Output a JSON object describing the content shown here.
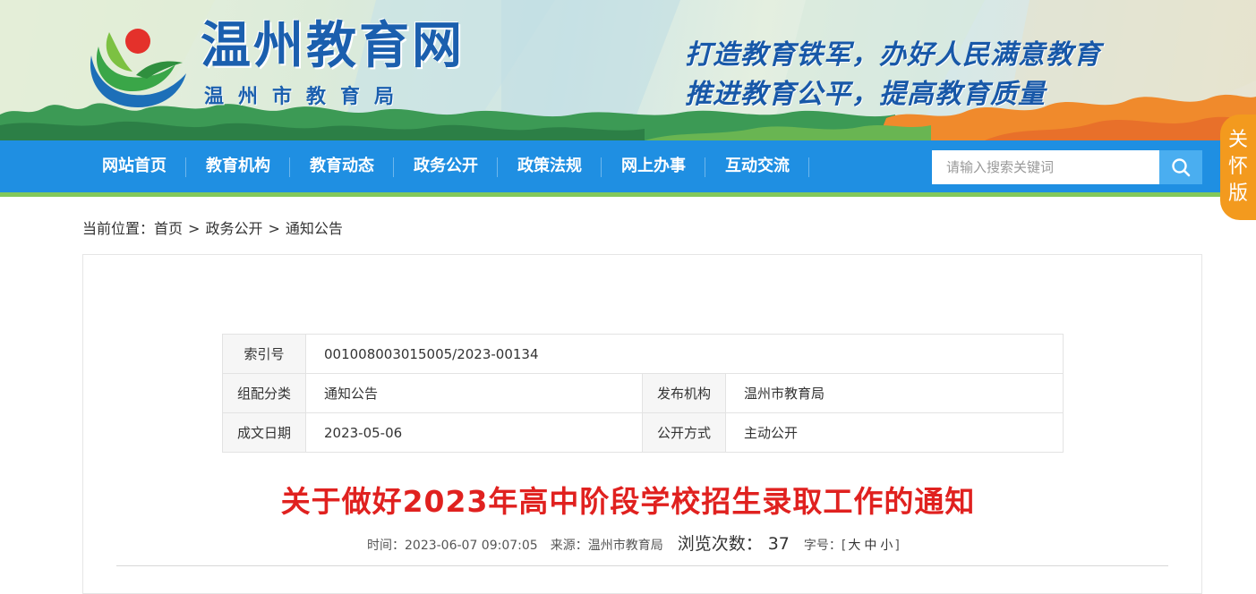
{
  "header": {
    "site_name": "温州教育网",
    "site_subtitle": "温州市教育局",
    "slogan_line1": "打造教育铁军，办好人民满意教育",
    "slogan_line2": "推进教育公平，提高教育质量",
    "logo_icon": "sun-over-green-leaves-logo"
  },
  "nav": {
    "items": [
      "网站首页",
      "教育机构",
      "教育动态",
      "政务公开",
      "政策法规",
      "网上办事",
      "互动交流"
    ],
    "search_placeholder": "请输入搜索关键词",
    "search_icon": "search-icon",
    "care_mode_label": "关怀版"
  },
  "breadcrumb": {
    "prefix": "当前位置：",
    "items": [
      "首页",
      "政务公开",
      "通知公告"
    ],
    "separator": ">"
  },
  "info": {
    "index_label": "索引号",
    "index_value": "001008003015005/2023-00134",
    "category_label": "组配分类",
    "category_value": "通知公告",
    "publisher_label": "发布机构",
    "publisher_value": "温州市教育局",
    "date_label": "成文日期",
    "date_value": "2023-05-06",
    "disclosure_label": "公开方式",
    "disclosure_value": "主动公开"
  },
  "article": {
    "title": "关于做好2023年高中阶段学校招生录取工作的通知",
    "time_label": "时间：",
    "time_value": "2023-06-07 09:07:05",
    "source_label": "来源：",
    "source_value": "温州市教育局",
    "views_label": "浏览次数：",
    "views_value": "37",
    "font_size_label": "字号：",
    "font_size_open": "[",
    "font_size_large": "大",
    "font_size_medium": "中",
    "font_size_small": "小",
    "font_size_close": "]"
  },
  "colors": {
    "nav_bg": "#1f8fe2",
    "nav_underline": "#83c85a",
    "brand_blue": "#1b5fae",
    "title_red": "#e0211f",
    "care_orange": "#f39a1e"
  }
}
